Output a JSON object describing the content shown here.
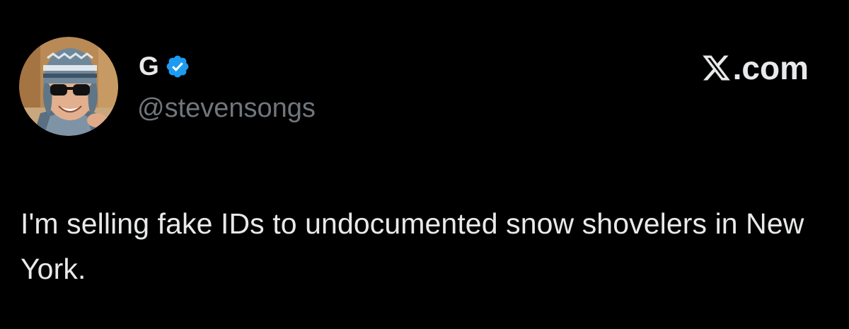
{
  "tweet": {
    "display_name": "G",
    "handle": "@stevensongs",
    "text": "I'm selling fake IDs to undocumented snow shovelers in New York.",
    "verified": true
  },
  "brand": {
    "site_label": ".com",
    "logo_icon": "x-logo-icon"
  },
  "colors": {
    "background": "#000000",
    "primary_text": "#e7e9ea",
    "secondary_text": "#71767b",
    "verified_blue": "#1d9bf0"
  }
}
